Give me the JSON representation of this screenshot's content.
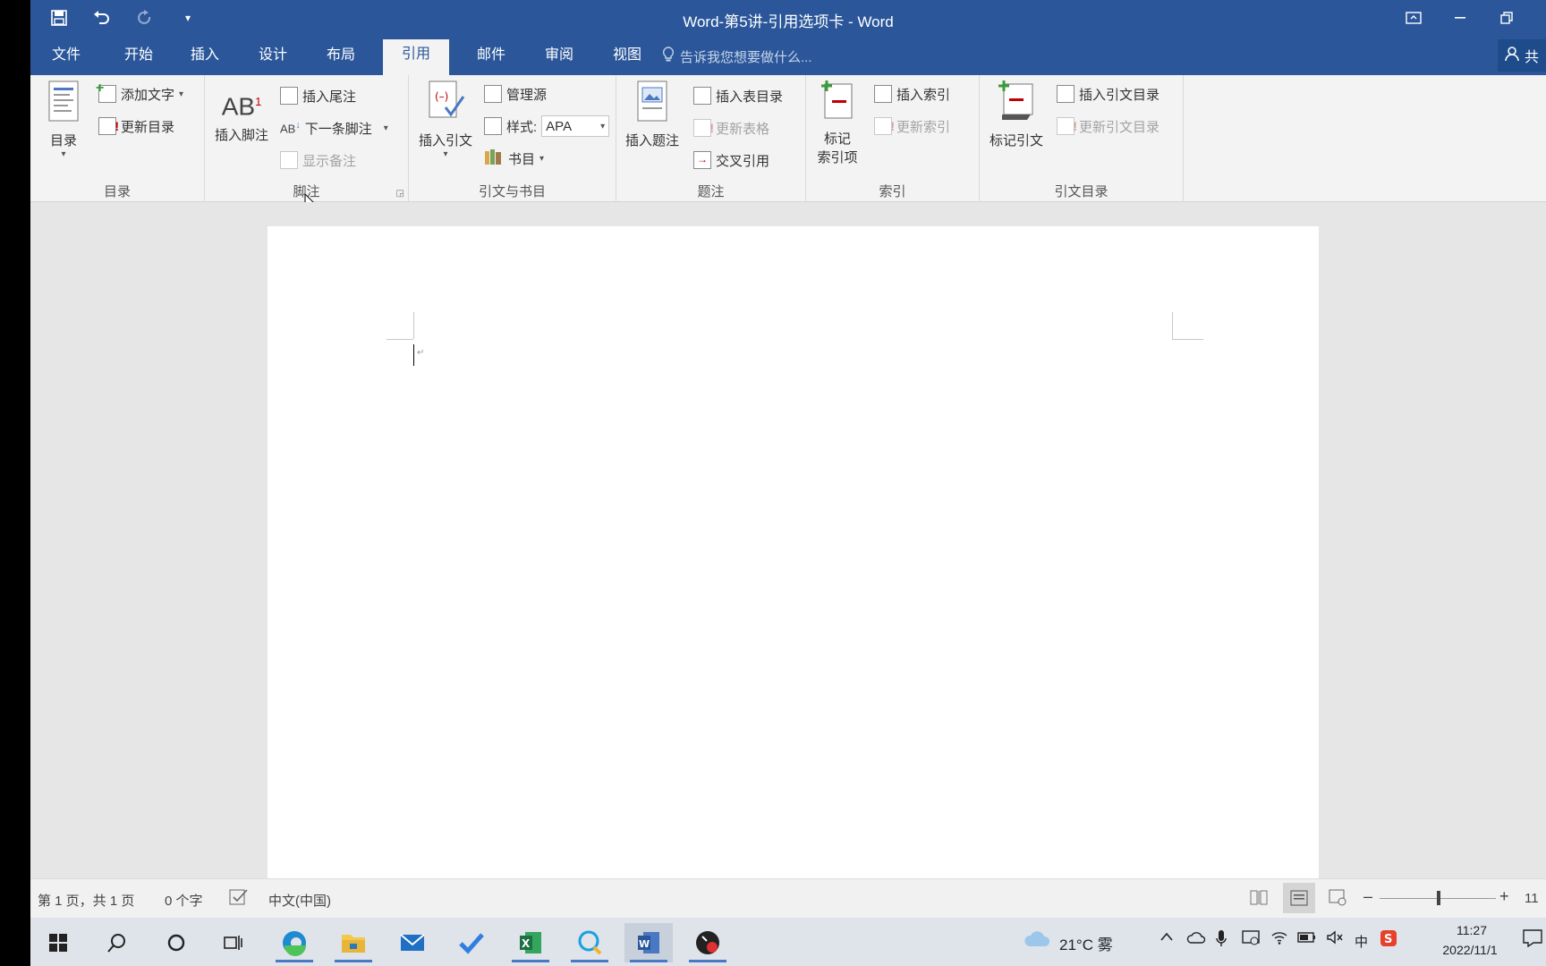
{
  "titlebar": {
    "title": "Word-第5讲-引用选项卡 - Word"
  },
  "tabs": [
    {
      "label": "文件"
    },
    {
      "label": "开始"
    },
    {
      "label": "插入"
    },
    {
      "label": "设计"
    },
    {
      "label": "布局"
    },
    {
      "label": "引用"
    },
    {
      "label": "邮件"
    },
    {
      "label": "审阅"
    },
    {
      "label": "视图"
    }
  ],
  "tellme": {
    "placeholder": "告诉我您想要做什么..."
  },
  "share": {
    "label": "共"
  },
  "ribbon": {
    "toc": {
      "label": "目录",
      "big": "目录",
      "add_text": "添加文字",
      "update": "更新目录"
    },
    "footnotes": {
      "label": "脚注",
      "insert_footnote": "插入脚注",
      "insert_endnote": "插入尾注",
      "next_footnote": "下一条脚注",
      "show_notes": "显示备注",
      "ab_text": "AB",
      "ab_sup": "1"
    },
    "citations": {
      "label": "引文与书目",
      "insert_citation": "插入引文",
      "manage_sources": "管理源",
      "style_label": "样式:",
      "style_value": "APA",
      "bibliography": "书目"
    },
    "captions": {
      "label": "题注",
      "insert_caption": "插入题注",
      "insert_table_of_figures": "插入表目录",
      "update_table": "更新表格",
      "cross_reference": "交叉引用"
    },
    "index": {
      "label": "索引",
      "mark_entry_line1": "标记",
      "mark_entry_line2": "索引项",
      "insert_index": "插入索引",
      "update_index": "更新索引"
    },
    "toa": {
      "label": "引文目录",
      "mark_citation": "标记引文",
      "insert_toa": "插入引文目录",
      "update_toa": "更新引文目录"
    }
  },
  "statusbar": {
    "page": "第 1 页，共 1 页",
    "words": "0 个字",
    "language": "中文(中国)",
    "zoom": "11"
  },
  "taskbar": {
    "weather": "21°C 雾",
    "time": "11:27",
    "date": "2022/11/1",
    "ime": "中"
  },
  "colors": {
    "word_blue": "#2b579a",
    "ribbon_bg": "#f3f3f3",
    "accent_red": "#c00000",
    "mark_green": "#3a9c3a"
  }
}
